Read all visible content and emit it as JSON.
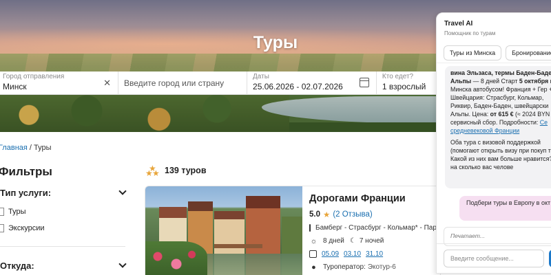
{
  "hero": {
    "title": "Туры"
  },
  "search": {
    "from_label": "Город отправления",
    "from_value": "Минск",
    "destination_placeholder": "Введите город или страну",
    "dates_label": "Даты",
    "dates_value": "25.06.2026 - 02.07.2026",
    "who_label": "Кто едет?",
    "who_value": "1 взрослый"
  },
  "breadcrumb": {
    "home": "Главная",
    "separator": " / ",
    "current": "Туры"
  },
  "filters": {
    "title": "Фильтры",
    "group1_title": "Тип услуги:",
    "options": [
      "Туры",
      "Экскурсии"
    ],
    "group2_title": "Откуда:"
  },
  "results": {
    "count_text": "139 туров"
  },
  "tour": {
    "name": "Дорогами Франции",
    "rating": "5.0",
    "reviews": "(2 Отзыва)",
    "route": "Бамберг - Страсбург - Кольмар* - Париж",
    "days": "8 дней",
    "nights": "7 ночей",
    "dates": [
      "05.09",
      "03.10",
      "31.10"
    ],
    "operator_label": "Туроператор:",
    "operator_name": "Экотур-6"
  },
  "chat": {
    "title": "Travel AI",
    "subtitle": "Помощник по турам",
    "chips": [
      "Туры из Минска",
      "Бронирование т"
    ],
    "bot_message": {
      "bold1": "вина Эльзаса, термы Баден-Баде",
      "bold2": "Альпы",
      "text1": " — 8 дней Старт ",
      "bold3": "5 октября и",
      "text2": "Минска автобусом! Франция + Гер + Швейцария: Страсбург, Кольмар, Риквир, Баден-Баден, швейцарски Альпы. Цена: ",
      "bold4": "от 615 €",
      "text3": " (≈ 2024 BYN сервисный сбор. Подробности: ",
      "link": "Се средневековой Франции",
      "para2": "Оба тура с визовой поддержкой (помогают открыть визу при покуп тура). Какой из них вам больше нравится? И на сколько вас челове"
    },
    "user_message": "Подбери туры в Европу в окт открытием визы",
    "typing": "Печатает...",
    "input_placeholder": "Введите сообщение..."
  }
}
